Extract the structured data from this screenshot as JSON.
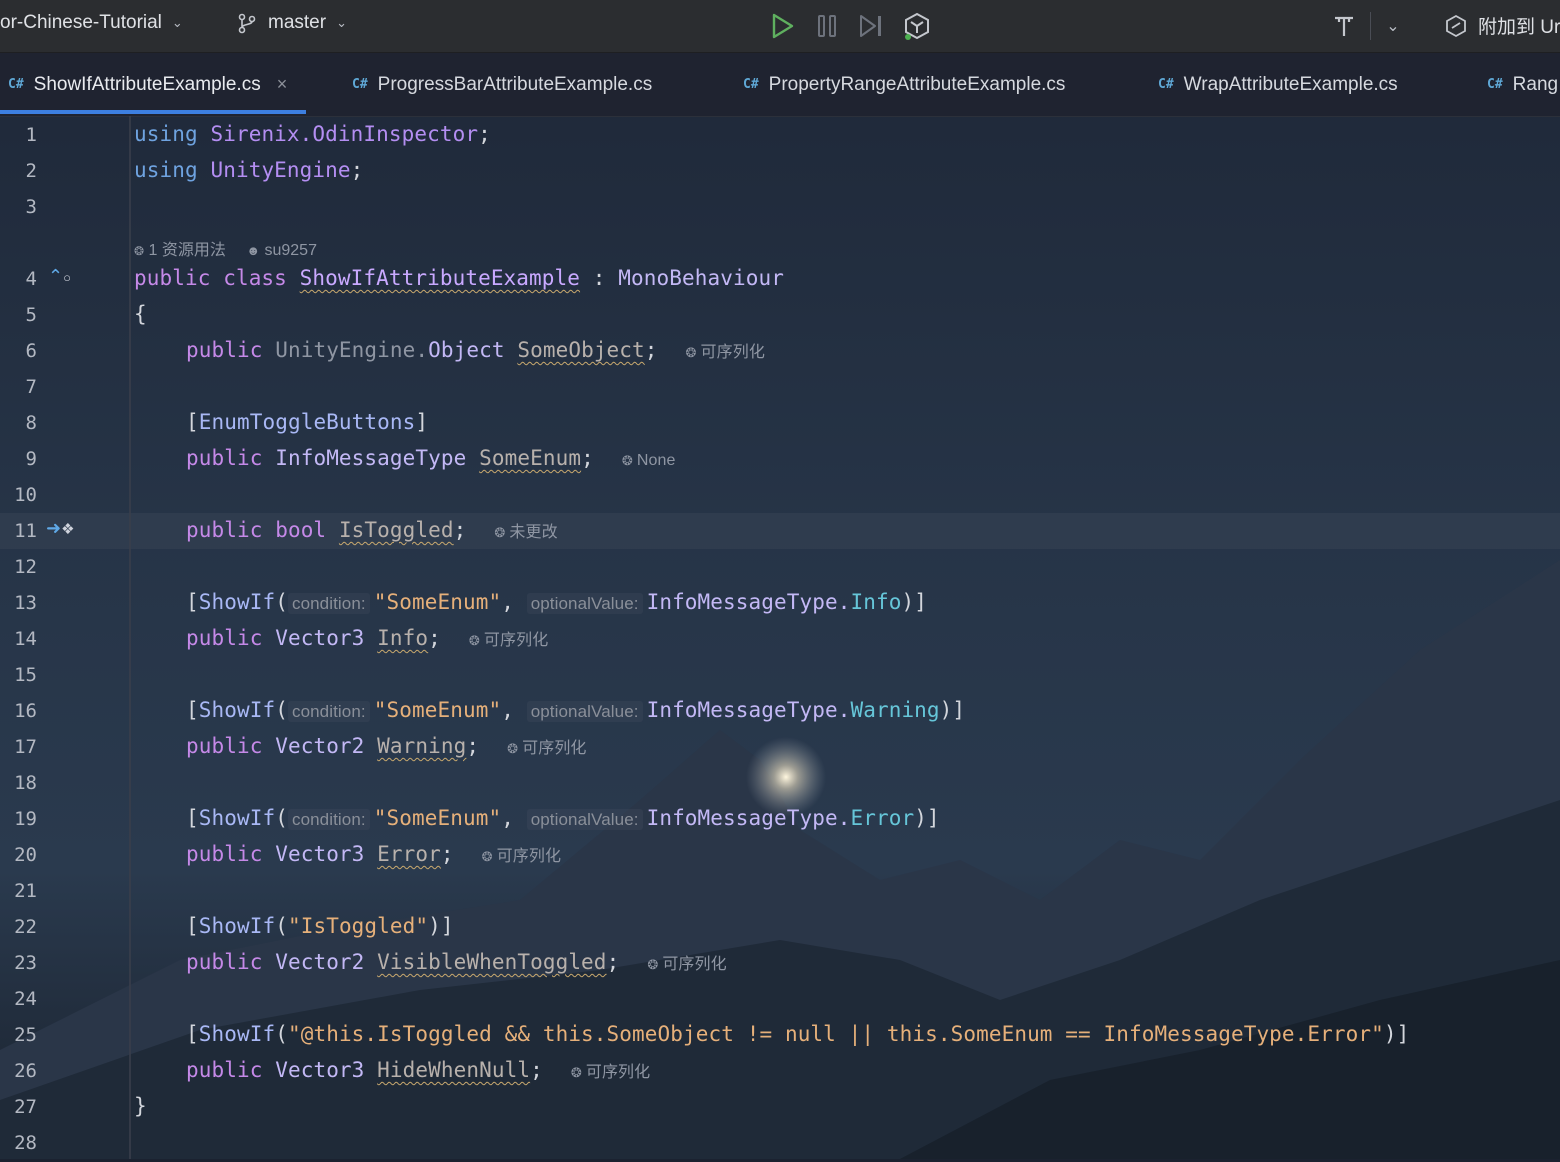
{
  "toolbar": {
    "project": "or-Chinese-Tutorial",
    "branch": "master",
    "attach_label": "附加到 Ur"
  },
  "tabs": [
    {
      "label": "ShowIfAttributeExample.cs",
      "lang": "C#",
      "active": true
    },
    {
      "label": "ProgressBarAttributeExample.cs",
      "lang": "C#"
    },
    {
      "label": "PropertyRangeAttributeExample.cs",
      "lang": "C#"
    },
    {
      "label": "WrapAttributeExample.cs",
      "lang": "C#"
    },
    {
      "label": "Rang",
      "lang": "C#"
    }
  ],
  "editor": {
    "line_numbers": [
      "1",
      "2",
      "3",
      "4",
      "5",
      "6",
      "7",
      "8",
      "9",
      "10",
      "11",
      "12",
      "13",
      "14",
      "15",
      "16",
      "17",
      "18",
      "19",
      "20",
      "21",
      "22",
      "23",
      "24",
      "25",
      "26",
      "27",
      "28"
    ],
    "codelens": {
      "usages": "1 资源用法",
      "author": "su9257"
    },
    "l1": {
      "kw": "using",
      "ns": "Sirenix.OdinInspector",
      "end": ";"
    },
    "l2": {
      "kw": "using",
      "ns": "UnityEngine",
      "end": ";"
    },
    "l4": {
      "kw": "public class",
      "name": "ShowIfAttributeExample",
      "colon": ":",
      "base": "MonoBehaviour"
    },
    "l5": "{",
    "l6": {
      "kw": "public",
      "ns": "UnityEngine.",
      "type": "Object",
      "field": "SomeObject",
      "end": ";",
      "inlay": "可序列化"
    },
    "l8": {
      "open": "[",
      "attr": "EnumToggleButtons",
      "close": "]"
    },
    "l9": {
      "kw": "public",
      "type": "InfoMessageType",
      "field": "SomeEnum",
      "end": ";",
      "inlay": "None"
    },
    "l11": {
      "kw": "public bool",
      "field": "IsToggled",
      "end": ";",
      "inlay": "未更改"
    },
    "l13": {
      "attr": "ShowIf",
      "hint1": "condition:",
      "str": "\"SomeEnum\"",
      "hint2": "optionalValue:",
      "type": "InfoMessageType.",
      "value": "Info"
    },
    "l14": {
      "kw": "public",
      "type": "Vector3",
      "field": "Info",
      "end": ";",
      "inlay": "可序列化"
    },
    "l16": {
      "attr": "ShowIf",
      "hint1": "condition:",
      "str": "\"SomeEnum\"",
      "hint2": "optionalValue:",
      "type": "InfoMessageType.",
      "value": "Warning"
    },
    "l17": {
      "kw": "public",
      "type": "Vector2",
      "field": "Warning",
      "end": ";",
      "inlay": "可序列化"
    },
    "l19": {
      "attr": "ShowIf",
      "hint1": "condition:",
      "str": "\"SomeEnum\"",
      "hint2": "optionalValue:",
      "type": "InfoMessageType.",
      "value": "Error"
    },
    "l20": {
      "kw": "public",
      "type": "Vector3",
      "field": "Error",
      "end": ";",
      "inlay": "可序列化"
    },
    "l22": {
      "attr": "ShowIf",
      "str": "\"IsToggled\""
    },
    "l23": {
      "kw": "public",
      "type": "Vector2",
      "field": "VisibleWhenToggled",
      "end": ";",
      "inlay": "可序列化"
    },
    "l25": {
      "attr": "ShowIf",
      "str": "\"@this.IsToggled && this.SomeObject != null || this.SomeEnum == InfoMessageType.Error\""
    },
    "l26": {
      "kw": "public",
      "type": "Vector3",
      "field": "HideWhenNull",
      "end": ";",
      "inlay": "可序列化"
    },
    "l27": "}"
  }
}
